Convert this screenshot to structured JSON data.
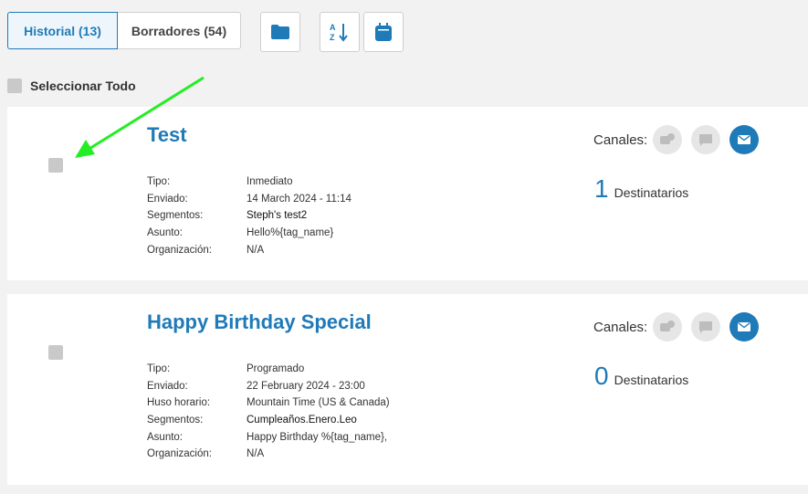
{
  "tabs": [
    {
      "label": "Historial (13)",
      "active": true
    },
    {
      "label": "Borradores (54)",
      "active": false
    }
  ],
  "toolbar_icons": [
    "folder-icon",
    "sort-az-icon",
    "calendar-icon"
  ],
  "select_all_label": "Seleccionar Todo",
  "colors": {
    "accent": "#1f7ab8",
    "arrow": "#22ee22"
  },
  "campaigns": [
    {
      "title": "Test",
      "fields": [
        {
          "key": "Tipo:",
          "value": "Inmediato"
        },
        {
          "key": "Enviado:",
          "value": "14 March 2024 - 11:14"
        },
        {
          "key": "Segmentos:",
          "value": "Steph's test2"
        },
        {
          "key": "Asunto:",
          "value": "Hello%{tag_name}"
        },
        {
          "key": "Organización:",
          "value": "N/A"
        }
      ],
      "channels_label": "Canales:",
      "channels": [
        "chat-bubbles-icon",
        "sms-icon",
        "email-icon"
      ],
      "active_channel": "email",
      "recipients_count": "1",
      "recipients_label": "Destinatarios"
    },
    {
      "title": "Happy Birthday Special",
      "fields": [
        {
          "key": "Tipo:",
          "value": "Programado"
        },
        {
          "key": "Enviado:",
          "value": "22 February 2024 - 23:00"
        },
        {
          "key": "Huso horario:",
          "value": "Mountain Time (US & Canada)"
        },
        {
          "key": "Segmentos:",
          "value": "Cumpleaños.Enero.Leo"
        },
        {
          "key": "Asunto:",
          "value": "Happy Birthday %{tag_name},"
        },
        {
          "key": "Organización:",
          "value": "N/A"
        }
      ],
      "channels_label": "Canales:",
      "channels": [
        "chat-bubbles-icon",
        "sms-icon",
        "email-icon"
      ],
      "active_channel": "email",
      "recipients_count": "0",
      "recipients_label": "Destinatarios"
    }
  ]
}
